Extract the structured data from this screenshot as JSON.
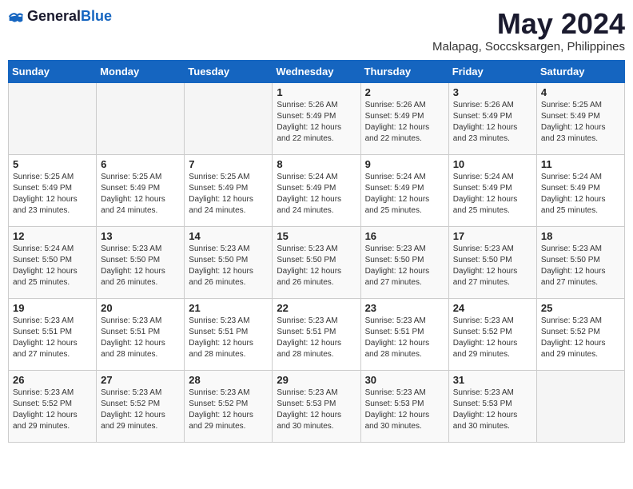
{
  "logo": {
    "general": "General",
    "blue": "Blue"
  },
  "title": {
    "month_year": "May 2024",
    "location": "Malapag, Soccsksargen, Philippines"
  },
  "headers": [
    "Sunday",
    "Monday",
    "Tuesday",
    "Wednesday",
    "Thursday",
    "Friday",
    "Saturday"
  ],
  "weeks": [
    [
      {
        "day": "",
        "info": ""
      },
      {
        "day": "",
        "info": ""
      },
      {
        "day": "",
        "info": ""
      },
      {
        "day": "1",
        "info": "Sunrise: 5:26 AM\nSunset: 5:49 PM\nDaylight: 12 hours\nand 22 minutes."
      },
      {
        "day": "2",
        "info": "Sunrise: 5:26 AM\nSunset: 5:49 PM\nDaylight: 12 hours\nand 22 minutes."
      },
      {
        "day": "3",
        "info": "Sunrise: 5:26 AM\nSunset: 5:49 PM\nDaylight: 12 hours\nand 23 minutes."
      },
      {
        "day": "4",
        "info": "Sunrise: 5:25 AM\nSunset: 5:49 PM\nDaylight: 12 hours\nand 23 minutes."
      }
    ],
    [
      {
        "day": "5",
        "info": "Sunrise: 5:25 AM\nSunset: 5:49 PM\nDaylight: 12 hours\nand 23 minutes."
      },
      {
        "day": "6",
        "info": "Sunrise: 5:25 AM\nSunset: 5:49 PM\nDaylight: 12 hours\nand 24 minutes."
      },
      {
        "day": "7",
        "info": "Sunrise: 5:25 AM\nSunset: 5:49 PM\nDaylight: 12 hours\nand 24 minutes."
      },
      {
        "day": "8",
        "info": "Sunrise: 5:24 AM\nSunset: 5:49 PM\nDaylight: 12 hours\nand 24 minutes."
      },
      {
        "day": "9",
        "info": "Sunrise: 5:24 AM\nSunset: 5:49 PM\nDaylight: 12 hours\nand 25 minutes."
      },
      {
        "day": "10",
        "info": "Sunrise: 5:24 AM\nSunset: 5:49 PM\nDaylight: 12 hours\nand 25 minutes."
      },
      {
        "day": "11",
        "info": "Sunrise: 5:24 AM\nSunset: 5:49 PM\nDaylight: 12 hours\nand 25 minutes."
      }
    ],
    [
      {
        "day": "12",
        "info": "Sunrise: 5:24 AM\nSunset: 5:50 PM\nDaylight: 12 hours\nand 25 minutes."
      },
      {
        "day": "13",
        "info": "Sunrise: 5:23 AM\nSunset: 5:50 PM\nDaylight: 12 hours\nand 26 minutes."
      },
      {
        "day": "14",
        "info": "Sunrise: 5:23 AM\nSunset: 5:50 PM\nDaylight: 12 hours\nand 26 minutes."
      },
      {
        "day": "15",
        "info": "Sunrise: 5:23 AM\nSunset: 5:50 PM\nDaylight: 12 hours\nand 26 minutes."
      },
      {
        "day": "16",
        "info": "Sunrise: 5:23 AM\nSunset: 5:50 PM\nDaylight: 12 hours\nand 27 minutes."
      },
      {
        "day": "17",
        "info": "Sunrise: 5:23 AM\nSunset: 5:50 PM\nDaylight: 12 hours\nand 27 minutes."
      },
      {
        "day": "18",
        "info": "Sunrise: 5:23 AM\nSunset: 5:50 PM\nDaylight: 12 hours\nand 27 minutes."
      }
    ],
    [
      {
        "day": "19",
        "info": "Sunrise: 5:23 AM\nSunset: 5:51 PM\nDaylight: 12 hours\nand 27 minutes."
      },
      {
        "day": "20",
        "info": "Sunrise: 5:23 AM\nSunset: 5:51 PM\nDaylight: 12 hours\nand 28 minutes."
      },
      {
        "day": "21",
        "info": "Sunrise: 5:23 AM\nSunset: 5:51 PM\nDaylight: 12 hours\nand 28 minutes."
      },
      {
        "day": "22",
        "info": "Sunrise: 5:23 AM\nSunset: 5:51 PM\nDaylight: 12 hours\nand 28 minutes."
      },
      {
        "day": "23",
        "info": "Sunrise: 5:23 AM\nSunset: 5:51 PM\nDaylight: 12 hours\nand 28 minutes."
      },
      {
        "day": "24",
        "info": "Sunrise: 5:23 AM\nSunset: 5:52 PM\nDaylight: 12 hours\nand 29 minutes."
      },
      {
        "day": "25",
        "info": "Sunrise: 5:23 AM\nSunset: 5:52 PM\nDaylight: 12 hours\nand 29 minutes."
      }
    ],
    [
      {
        "day": "26",
        "info": "Sunrise: 5:23 AM\nSunset: 5:52 PM\nDaylight: 12 hours\nand 29 minutes."
      },
      {
        "day": "27",
        "info": "Sunrise: 5:23 AM\nSunset: 5:52 PM\nDaylight: 12 hours\nand 29 minutes."
      },
      {
        "day": "28",
        "info": "Sunrise: 5:23 AM\nSunset: 5:52 PM\nDaylight: 12 hours\nand 29 minutes."
      },
      {
        "day": "29",
        "info": "Sunrise: 5:23 AM\nSunset: 5:53 PM\nDaylight: 12 hours\nand 30 minutes."
      },
      {
        "day": "30",
        "info": "Sunrise: 5:23 AM\nSunset: 5:53 PM\nDaylight: 12 hours\nand 30 minutes."
      },
      {
        "day": "31",
        "info": "Sunrise: 5:23 AM\nSunset: 5:53 PM\nDaylight: 12 hours\nand 30 minutes."
      },
      {
        "day": "",
        "info": ""
      }
    ]
  ]
}
